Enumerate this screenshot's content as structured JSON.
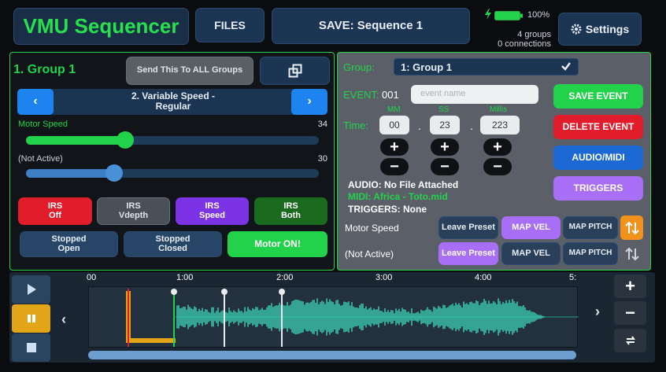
{
  "header": {
    "app_title": "VMU Sequencer",
    "files_label": "FILES",
    "save_label": "SAVE:  Sequence 1",
    "battery_percent": "100%",
    "groups_count": "4 groups",
    "connections_count": "0 connections",
    "settings_label": "Settings"
  },
  "group_panel": {
    "title": "1. Group 1",
    "send_all_label": "Send This To ALL Groups",
    "mode_line1": "2. Variable Speed -",
    "mode_line2": "Regular",
    "slider1_label": "Motor Speed",
    "slider1_value": "34",
    "slider1_fraction": 0.34,
    "slider2_label": "(Not Active)",
    "slider2_value": "30",
    "slider2_fraction": 0.3,
    "irs_off_l1": "IRS",
    "irs_off_l2": "Off",
    "irs_vdepth_l1": "IRS",
    "irs_vdepth_l2": "Vdepth",
    "irs_speed_l1": "IRS",
    "irs_speed_l2": "Speed",
    "irs_both_l1": "IRS",
    "irs_both_l2": "Both",
    "stopped_open_l1": "Stopped",
    "stopped_open_l2": "Open",
    "stopped_closed_l1": "Stopped",
    "stopped_closed_l2": "Closed",
    "motor_on_label": "Motor ON!"
  },
  "event_panel": {
    "group_label": "Group:",
    "group_selected": "1:  Group 1",
    "event_label": "EVENT:",
    "event_number": "001",
    "event_name_placeholder": "event name",
    "time_label": "Time:",
    "mm_label": "MM",
    "ss_label": "SS",
    "millis_label": "Millis",
    "mm_value": "00",
    "ss_value": "23",
    "millis_value": "223",
    "dot": ".",
    "plus": "+",
    "minus": "−",
    "audio_info": "AUDIO: No File Attached",
    "midi_info": "MIDI: Africa - Toto.mid",
    "triggers_info": "TRIGGERS: None",
    "save_event": "SAVE EVENT",
    "delete_event": "DELETE EVENT",
    "audio_midi": "AUDIO/MIDI",
    "triggers": "TRIGGERS",
    "row1_label": "Motor Speed",
    "row2_label": "(Not Active)",
    "leave_preset": "Leave Preset",
    "map_vel": "MAP VEL",
    "map_pitch": "MAP PITCH"
  },
  "timeline": {
    "ticks": [
      "00",
      "1:00",
      "2:00",
      "3:00",
      "4:00",
      "5:"
    ]
  },
  "colors": {
    "accent_green": "#21d24a",
    "red": "#e11d2b",
    "purple": "#a86ef5",
    "blue": "#1c68d4",
    "waveform": "#3ed6b6",
    "orange": "#f0921c"
  }
}
